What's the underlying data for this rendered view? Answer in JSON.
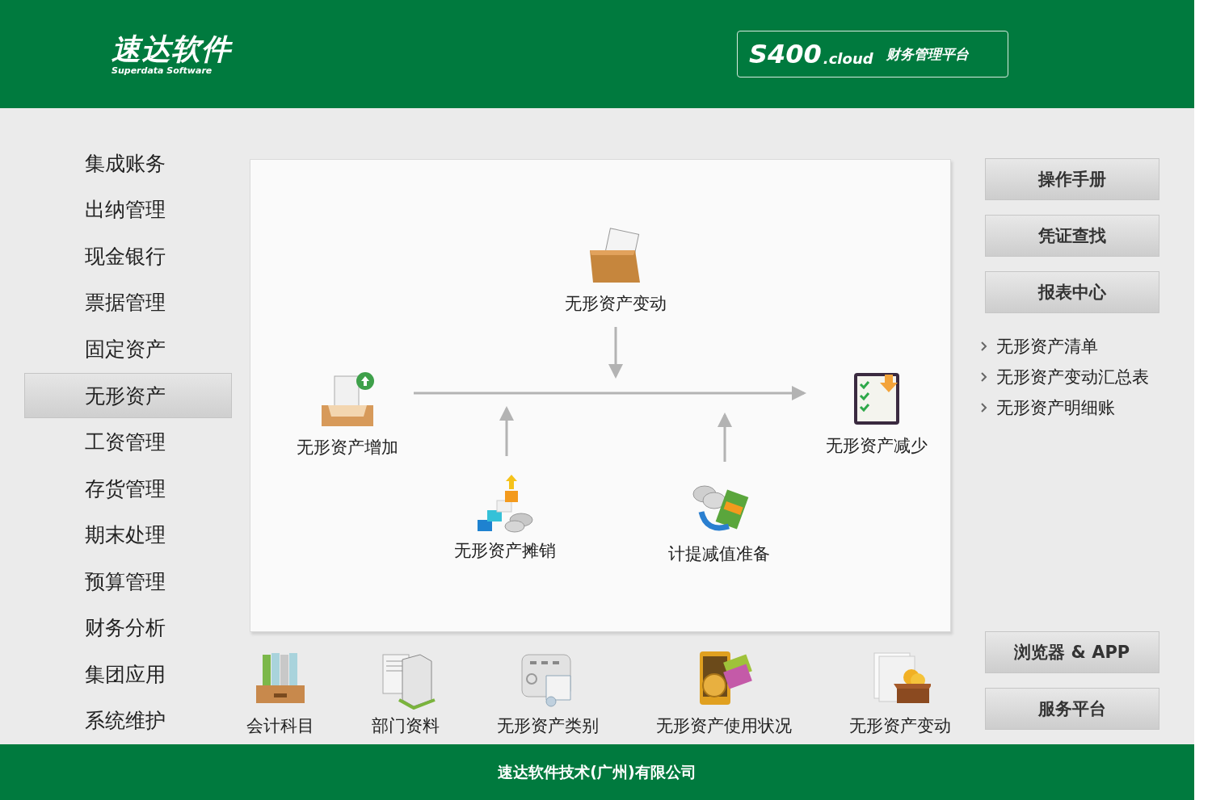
{
  "header": {
    "logo_title": "速达软件",
    "logo_subtitle": "Superdata Software",
    "product": {
      "name": "S400",
      "suffix": ".cloud",
      "tagline": "财务管理平台"
    }
  },
  "sidebar": {
    "items": [
      {
        "label": "集成账务",
        "selected": false
      },
      {
        "label": "出纳管理",
        "selected": false
      },
      {
        "label": "现金银行",
        "selected": false
      },
      {
        "label": "票据管理",
        "selected": false
      },
      {
        "label": "固定资产",
        "selected": false
      },
      {
        "label": "无形资产",
        "selected": true
      },
      {
        "label": "工资管理",
        "selected": false
      },
      {
        "label": "存货管理",
        "selected": false
      },
      {
        "label": "期末处理",
        "selected": false
      },
      {
        "label": "预算管理",
        "selected": false
      },
      {
        "label": "财务分析",
        "selected": false
      },
      {
        "label": "集团应用",
        "selected": false
      },
      {
        "label": "系统维护",
        "selected": false
      }
    ]
  },
  "flow": {
    "nodes": [
      {
        "label": "无形资产变动",
        "kind": "folder"
      },
      {
        "label": "无形资产增加",
        "kind": "inbox"
      },
      {
        "label": "无形资产减少",
        "kind": "checklist"
      },
      {
        "label": "无形资产摊销",
        "kind": "stairs"
      },
      {
        "label": "计提减值准备",
        "kind": "coins"
      }
    ]
  },
  "shortcuts": [
    {
      "label": "会计科目",
      "kind": "binders"
    },
    {
      "label": "部门资料",
      "kind": "building"
    },
    {
      "label": "无形资产类别",
      "kind": "certificate"
    },
    {
      "label": "无形资产使用状况",
      "kind": "phone-money"
    },
    {
      "label": "无形资产变动",
      "kind": "box"
    }
  ],
  "top_buttons": [
    "操作手册",
    "凭证查找",
    "报表中心"
  ],
  "report_links": [
    "无形资产清单",
    "无形资产变动汇总表",
    "无形资产明细账"
  ],
  "bottom_buttons": [
    "浏览器 & APP",
    "服务平台"
  ],
  "footer": {
    "text": "速达软件技术(广州)有限公司"
  }
}
